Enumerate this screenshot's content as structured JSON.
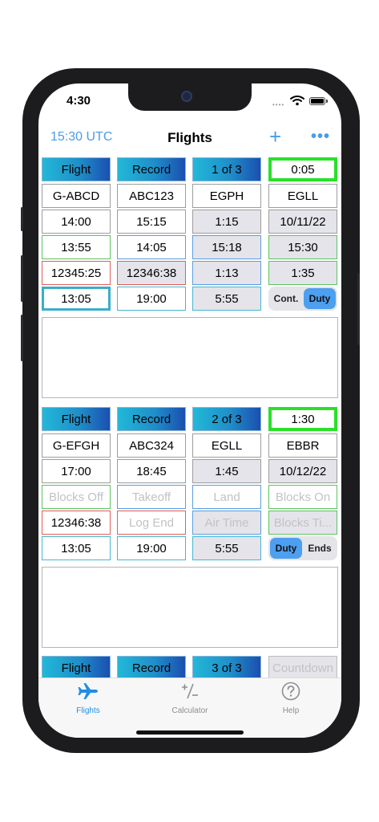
{
  "status_bar": {
    "time": "4:30",
    "dots": "••••"
  },
  "nav": {
    "utc": "15:30 UTC",
    "title": "Flights",
    "add_glyph": "+",
    "more_glyph": "•••"
  },
  "flights": [
    {
      "hdr": {
        "flight": "Flight",
        "record": "Record",
        "index": "1 of 3",
        "countdown": "0:05"
      },
      "reg": "G-ABCD",
      "code": "ABC123",
      "from": "EGPH",
      "to": "EGLL",
      "sched_dep": "14:00",
      "sched_arr": "15:15",
      "sched_dur": "1:15",
      "date": "10/11/22",
      "blocks_off": "13:55",
      "takeoff": "14:05",
      "land": "15:18",
      "blocks_on": "15:30",
      "log_start": "12345:25",
      "log_end": "12346:38",
      "air_time": "1:13",
      "blocks_time": "1:35",
      "duty_start": "13:05",
      "duty_end": "19:00",
      "duty_time": "5:55",
      "seg": {
        "left": "Cont.",
        "right": "Duty"
      }
    },
    {
      "hdr": {
        "flight": "Flight",
        "record": "Record",
        "index": "2 of 3",
        "countdown": "1:30"
      },
      "reg": "G-EFGH",
      "code": "ABC324",
      "from": "EGLL",
      "to": "EBBR",
      "sched_dep": "17:00",
      "sched_arr": "18:45",
      "sched_dur": "1:45",
      "date": "10/12/22",
      "blocks_off_ph": "Blocks Off",
      "takeoff_ph": "Takeoff",
      "land_ph": "Land",
      "blocks_on_ph": "Blocks On",
      "log_start": "12346:38",
      "log_end_ph": "Log End",
      "air_time_ph": "Air Time",
      "blocks_time_ph": "Blocks Ti...",
      "duty_start": "13:05",
      "duty_end": "19:00",
      "duty_time": "5:55",
      "seg": {
        "left": "Duty",
        "right": "Ends"
      }
    },
    {
      "hdr": {
        "flight": "Flight",
        "record": "Record",
        "index": "3 of 3",
        "countdown_ph": "Countdown"
      }
    }
  ],
  "tabs": [
    {
      "label": "Flights",
      "icon": "airplane-icon"
    },
    {
      "label": "Calculator",
      "icon": "calculator-icon"
    },
    {
      "label": "Help",
      "icon": "help-icon"
    }
  ],
  "colors": {
    "accent": "#4a9ce8",
    "countdown_border": "#2ae02a",
    "header_start": "#22b8d8",
    "header_end": "#1b4fb0"
  }
}
